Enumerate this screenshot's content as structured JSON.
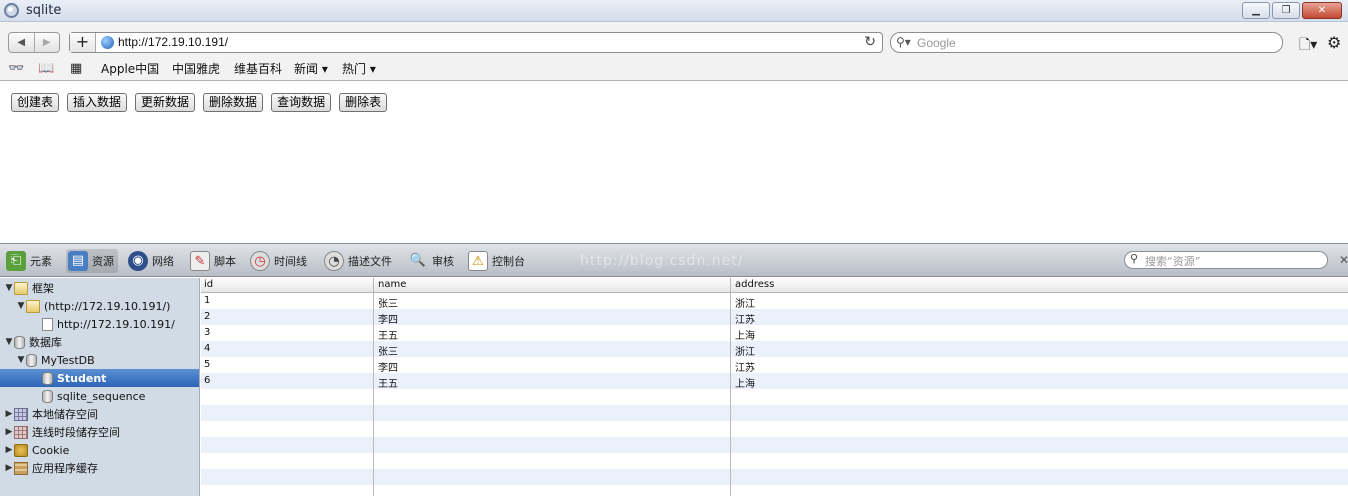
{
  "window": {
    "title": "sqlite"
  },
  "navbar": {
    "url": "http://172.19.10.191/",
    "search_placeholder": "Google"
  },
  "bookmarks": {
    "items": [
      {
        "label": "Apple中国"
      },
      {
        "label": "中国雅虎"
      },
      {
        "label": "维基百科"
      },
      {
        "label": "新闻 ▾"
      },
      {
        "label": "热门 ▾"
      }
    ]
  },
  "page": {
    "buttons": [
      {
        "label": "创建表"
      },
      {
        "label": "插入数据"
      },
      {
        "label": "更新数据"
      },
      {
        "label": "删除数据"
      },
      {
        "label": "查询数据"
      },
      {
        "label": "删除表"
      }
    ]
  },
  "inspector": {
    "tools": [
      {
        "label": "元素",
        "icon": "elements-icon"
      },
      {
        "label": "资源",
        "icon": "resources-icon"
      },
      {
        "label": "网络",
        "icon": "network-icon"
      },
      {
        "label": "脚本",
        "icon": "scripts-icon"
      },
      {
        "label": "时间线",
        "icon": "timeline-icon"
      },
      {
        "label": "描述文件",
        "icon": "profiles-icon"
      },
      {
        "label": "审核",
        "icon": "audits-icon"
      },
      {
        "label": "控制台",
        "icon": "console-icon"
      }
    ],
    "watermark": "http://blog.csdn.net/",
    "search_placeholder": "搜索“资源”"
  },
  "sidebar": {
    "items": [
      {
        "label": "框架"
      },
      {
        "label": "(http://172.19.10.191/)"
      },
      {
        "label": "http://172.19.10.191/"
      },
      {
        "label": "数据库"
      },
      {
        "label": "MyTestDB"
      },
      {
        "label": "Student"
      },
      {
        "label": "sqlite_sequence"
      },
      {
        "label": "本地储存空间"
      },
      {
        "label": "连线时段储存空间"
      },
      {
        "label": "Cookie"
      },
      {
        "label": "应用程序缓存"
      }
    ]
  },
  "table": {
    "columns": [
      "id",
      "name",
      "address"
    ],
    "rows": [
      [
        "1",
        "张三",
        "浙江"
      ],
      [
        "2",
        "李四",
        "江苏"
      ],
      [
        "3",
        "王五",
        "上海"
      ],
      [
        "4",
        "张三",
        "浙江"
      ],
      [
        "5",
        "李四",
        "江苏"
      ],
      [
        "6",
        "王五",
        "上海"
      ]
    ]
  }
}
